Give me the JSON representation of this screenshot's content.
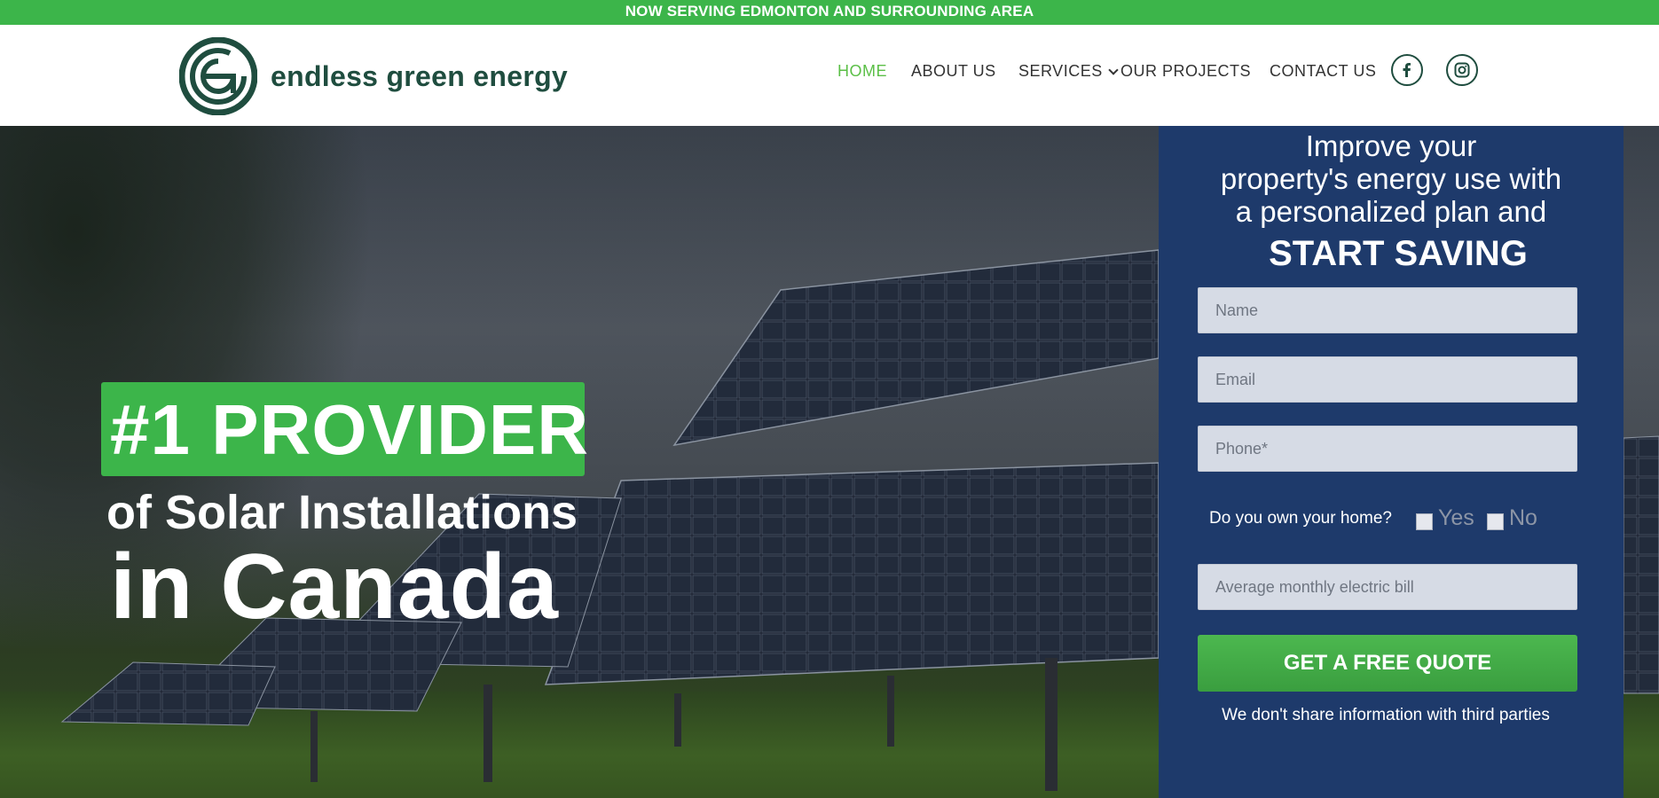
{
  "topbar": {
    "text": "NOW SERVING EDMONTON AND SURROUNDING AREA"
  },
  "brand": {
    "name": "endless green energy"
  },
  "nav": {
    "items": [
      {
        "label": "HOME",
        "active": true
      },
      {
        "label": "ABOUT US",
        "active": false
      },
      {
        "label": "SERVICES",
        "active": false,
        "has_dropdown": true
      },
      {
        "label": "OUR PROJECTS",
        "active": false
      },
      {
        "label": "CONTACT US",
        "active": false
      }
    ],
    "social": [
      {
        "icon": "facebook-icon",
        "glyph": "f"
      },
      {
        "icon": "instagram-icon",
        "glyph": "◎"
      }
    ]
  },
  "hero": {
    "badge": "#1 PROVIDER",
    "line2": "of Solar Installations",
    "line3": "in Canada"
  },
  "form": {
    "heading_lines": [
      "Improve your",
      "property's energy use with",
      "a personalized plan and"
    ],
    "heading_strong": "START SAVING",
    "name_placeholder": "Name",
    "email_placeholder": "Email",
    "phone_placeholder": "Phone*",
    "own_question": "Do you own your home?",
    "yes_label": "Yes",
    "no_label": "No",
    "bill_placeholder": "Average monthly electric bill",
    "submit_label": "GET A FREE QUOTE",
    "privacy_note": "We don't share information with third parties"
  },
  "colors": {
    "accent_green": "#3cb54a",
    "nav_active": "#5bbf47",
    "brand_dark": "#1f4d3f",
    "form_bg": "#1e3a6b"
  }
}
